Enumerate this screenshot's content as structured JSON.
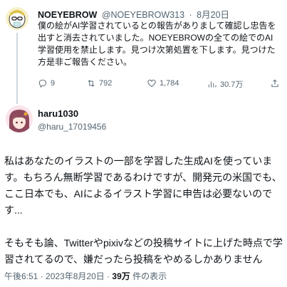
{
  "tweet1": {
    "name": "NOEYEBROW",
    "handle": "@NOEYEBROW313",
    "sep": "·",
    "date": "8月20日",
    "text": "僕の絵がAI学習されているとの報告がありまして確認し忠告を出すと消去されていました。NOEYEBROWの全ての絵でのAI学習使用を禁止します。見つけ次第処置を下します。見つけた方是非ご報告ください。",
    "replies": "9",
    "retweets": "792",
    "likes": "1,784",
    "views": "30.7万"
  },
  "tweet2": {
    "name": "haru1030",
    "handle": "@haru_17019456",
    "text": "私はあなたのイラストの一部を学習した生成AIを使っています。もちろん無断学習であるわけですが、開発元の米国でも、ここ日本でも、AIによるイラスト学習に申告は必要ないのです...\n\nそもそも論、Twitterやpixivなどの投稿サイトに上げた時点で学習されてるので、嫌だったら投稿をやめるしかありません",
    "time": "午後6:51 · 2023年8月20日 · ",
    "views_count": "39万",
    "views_label": " 件の表示"
  },
  "icons": [
    "reply-icon",
    "retweet-icon",
    "like-icon",
    "views-icon"
  ],
  "colors": {
    "secondary_text": "#536471",
    "primary_text": "#0f1419",
    "thread_line": "#cfd9de"
  }
}
